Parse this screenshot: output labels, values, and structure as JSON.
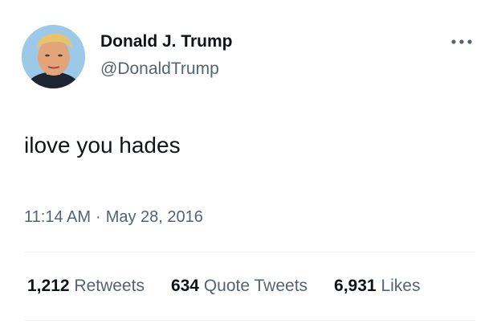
{
  "author": {
    "display_name": "Donald J. Trump",
    "handle": "@DonaldTrump"
  },
  "tweet": {
    "text": "ilove you hades",
    "time": "11:14 AM",
    "separator": "·",
    "date": "May 28, 2016"
  },
  "stats": {
    "retweets_count": "1,212",
    "retweets_label": "Retweets",
    "quotes_count": "634",
    "quotes_label": "Quote Tweets",
    "likes_count": "6,931",
    "likes_label": "Likes"
  },
  "icons": {
    "more": "more-horizontal-icon",
    "avatar": "profile-photo"
  },
  "colors": {
    "primary_text": "#0f1419",
    "secondary_text": "#536471",
    "divider": "#eff3f4"
  }
}
